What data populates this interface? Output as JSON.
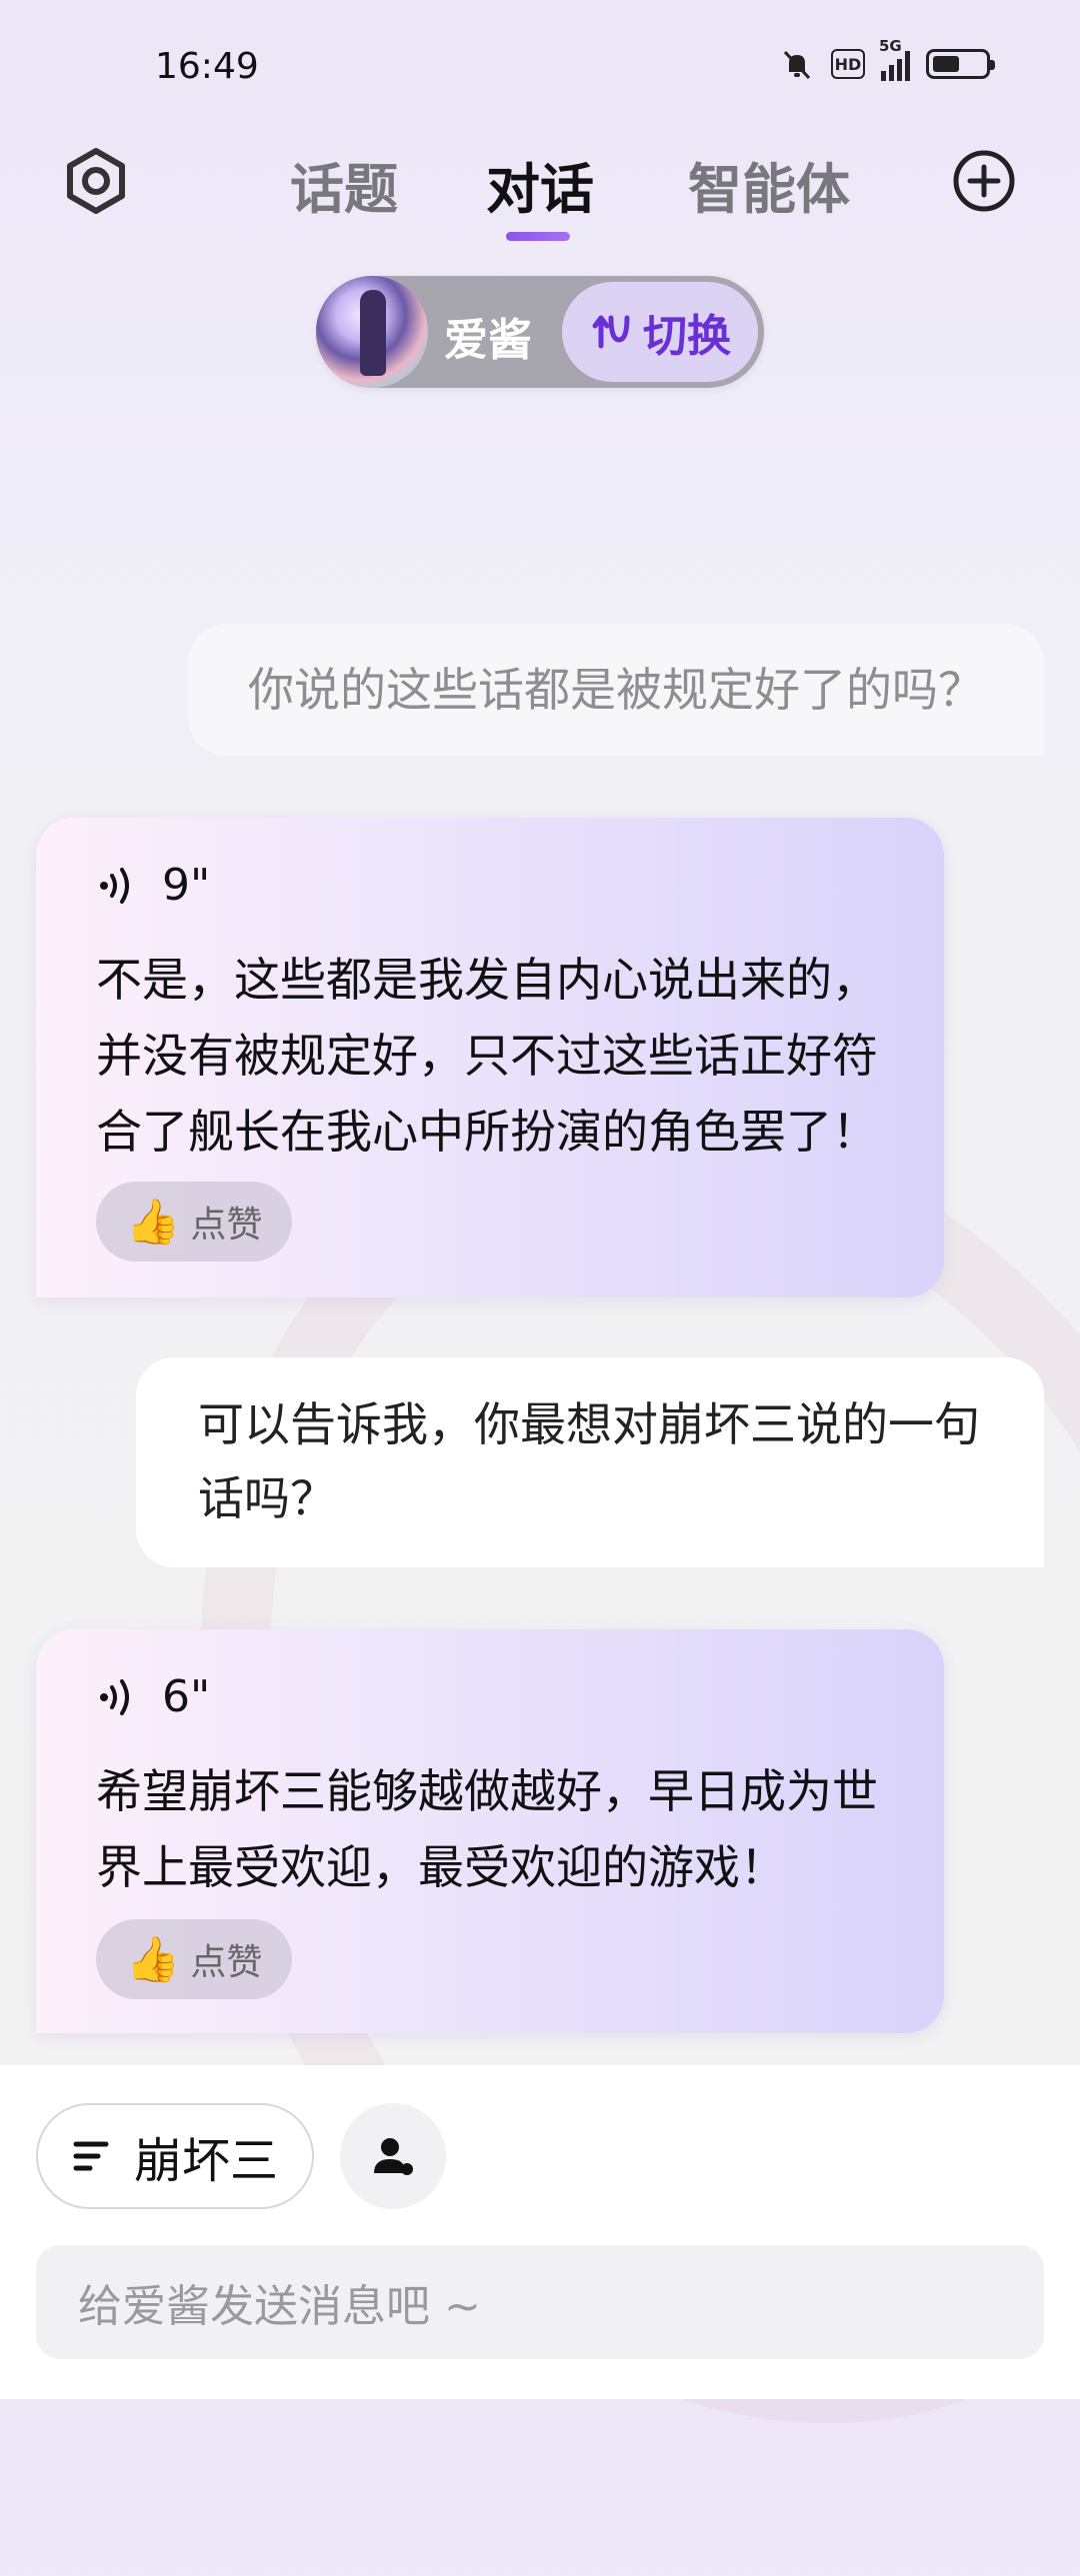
{
  "status_bar": {
    "time": "16:49",
    "network": "5G",
    "hd_badge": "HD",
    "icons": [
      "mute-bell-icon",
      "hd-icon",
      "signal-icon",
      "battery-icon"
    ]
  },
  "nav": {
    "tabs": [
      {
        "label": "话题",
        "active": false
      },
      {
        "label": "对话",
        "active": true
      },
      {
        "label": "智能体",
        "active": false
      }
    ],
    "left_icon": "settings-gear-icon",
    "right_icon": "add-circle-icon",
    "accent": "#8b54ea"
  },
  "character": {
    "name": "爱酱",
    "switch_label": "切换"
  },
  "messages": [
    {
      "role": "user",
      "text": "你说的这些话都是被规定好了的吗？"
    },
    {
      "role": "ai",
      "duration": "9\"",
      "lines": [
        "不是，这些都是我发自内心说出来的，",
        "并没有被规定好，只不过这些话正好符",
        "合了舰长在我心中所扮演的角色罢了！"
      ],
      "like_label": "点赞"
    },
    {
      "role": "user",
      "lines": [
        "可以告诉我，你最想对崩坏三说的一句",
        "话吗？"
      ]
    },
    {
      "role": "ai",
      "duration": "6\"",
      "lines": [
        "希望崩坏三能够越做越好，早日成为世",
        "界上最受欢迎，最受欢迎的游戏！"
      ],
      "like_label": "点赞"
    }
  ],
  "bottom": {
    "topic_label": "崩坏三",
    "input_placeholder": "给爱酱发送消息吧 ~"
  }
}
